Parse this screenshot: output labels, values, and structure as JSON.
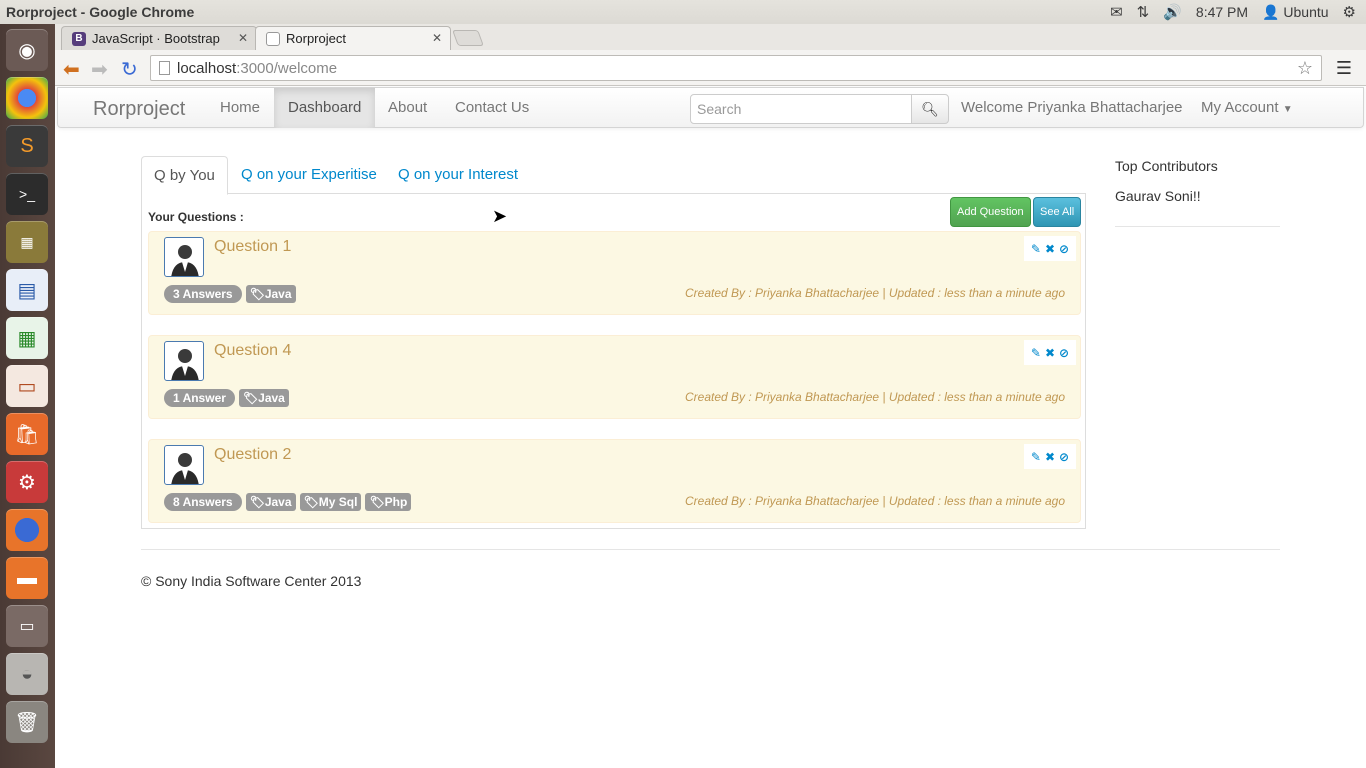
{
  "os": {
    "window_title": "Rorproject - Google Chrome",
    "clock": "8:47 PM",
    "user": "Ubuntu"
  },
  "browser": {
    "tabs": [
      {
        "label": "JavaScript · Bootstrap",
        "favicon": "B"
      },
      {
        "label": "Rorproject"
      }
    ],
    "url_host": "localhost",
    "url_rest": ":3000/welcome"
  },
  "navbar": {
    "brand": "Rorproject",
    "items": [
      "Home",
      "Dashboard",
      "About",
      "Contact Us"
    ],
    "active_item": "Dashboard",
    "search_placeholder": "Search",
    "welcome": "Welcome Priyanka Bhattacharjee",
    "account": "My Account"
  },
  "content_tabs": [
    "Q by You",
    "Q on your Experitise",
    "Q on your Interest"
  ],
  "your_questions_label": "Your Questions :",
  "buttons": {
    "add_question": "Add Question",
    "see_all": "See All"
  },
  "questions": [
    {
      "title": "Question 1",
      "answers": "3 Answers",
      "tags": [
        "Java"
      ],
      "meta": "Created By : Priyanka Bhattacharjee  | Updated : less than a minute ago"
    },
    {
      "title": "Question 4",
      "answers": "1 Answer",
      "tags": [
        "Java"
      ],
      "meta": "Created By : Priyanka Bhattacharjee  | Updated : less than a minute ago"
    },
    {
      "title": "Question 2",
      "answers": "8 Answers",
      "tags": [
        "Java",
        "My Sql",
        "Php"
      ],
      "meta": "Created By : Priyanka Bhattacharjee  | Updated : less than a minute ago"
    }
  ],
  "sidebar": {
    "heading": "Top Contributors",
    "contributor": "Gaurav Soni!!"
  },
  "footer": "© Sony India Software Center 2013",
  "colors": {
    "link": "#0088cc",
    "warning_text": "#c09853",
    "warning_bg": "#fcf8e3",
    "success": "#51a351",
    "info": "#2f96b4"
  }
}
